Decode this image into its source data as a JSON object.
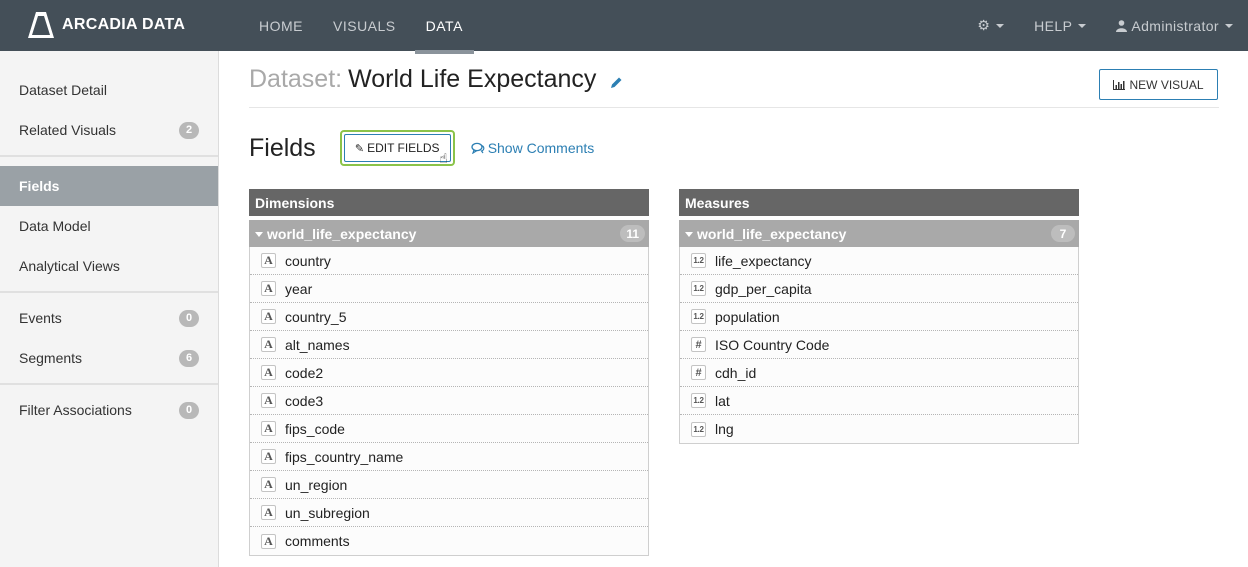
{
  "app": {
    "brand": "ARCADIA DATA",
    "nav": [
      {
        "label": "HOME",
        "active": false
      },
      {
        "label": "VISUALS",
        "active": false
      },
      {
        "label": "DATA",
        "active": true
      }
    ],
    "right_nav": {
      "settings_icon": "gear-icon",
      "help_label": "HELP",
      "user_label": "Administrator"
    }
  },
  "sidebar": {
    "groups": [
      [
        {
          "label": "Dataset Detail",
          "badge": null
        },
        {
          "label": "Related Visuals",
          "badge": "2"
        }
      ],
      [
        {
          "label": "Fields",
          "badge": null,
          "active": true
        },
        {
          "label": "Data Model",
          "badge": null
        },
        {
          "label": "Analytical Views",
          "badge": null
        }
      ],
      [
        {
          "label": "Events",
          "badge": "0"
        },
        {
          "label": "Segments",
          "badge": "6"
        }
      ],
      [
        {
          "label": "Filter Associations",
          "badge": "0"
        }
      ]
    ]
  },
  "main": {
    "title_prefix": "Dataset:",
    "title_name": "World Life Expectancy",
    "new_visual_label": "NEW VISUAL",
    "fields_title": "Fields",
    "edit_fields_label": "EDIT FIELDS",
    "show_comments_label": "Show Comments",
    "dimensions": {
      "header": "Dimensions",
      "group_name": "world_life_expectancy",
      "count": "11",
      "fields": [
        {
          "name": "country",
          "type": "text"
        },
        {
          "name": "year",
          "type": "text"
        },
        {
          "name": "country_5",
          "type": "text"
        },
        {
          "name": "alt_names",
          "type": "text"
        },
        {
          "name": "code2",
          "type": "text"
        },
        {
          "name": "code3",
          "type": "text"
        },
        {
          "name": "fips_code",
          "type": "text"
        },
        {
          "name": "fips_country_name",
          "type": "text"
        },
        {
          "name": "un_region",
          "type": "text"
        },
        {
          "name": "un_subregion",
          "type": "text"
        },
        {
          "name": "comments",
          "type": "text"
        }
      ]
    },
    "measures": {
      "header": "Measures",
      "group_name": "world_life_expectancy",
      "count": "7",
      "fields": [
        {
          "name": "life_expectancy",
          "type": "real"
        },
        {
          "name": "gdp_per_capita",
          "type": "real"
        },
        {
          "name": "population",
          "type": "real"
        },
        {
          "name": "ISO Country Code",
          "type": "integer"
        },
        {
          "name": "cdh_id",
          "type": "integer"
        },
        {
          "name": "lat",
          "type": "real"
        },
        {
          "name": "lng",
          "type": "real"
        }
      ]
    },
    "type_glyphs": {
      "text": "A",
      "real": "1.2",
      "integer": "#"
    }
  },
  "colors": {
    "topbar": "#444f58",
    "accent_blue": "#2c7fb3",
    "highlight_green": "#8bc34a",
    "sidebar_active": "#9aa1a6",
    "panel_header": "#666666",
    "group_header": "#a9a9a9"
  }
}
